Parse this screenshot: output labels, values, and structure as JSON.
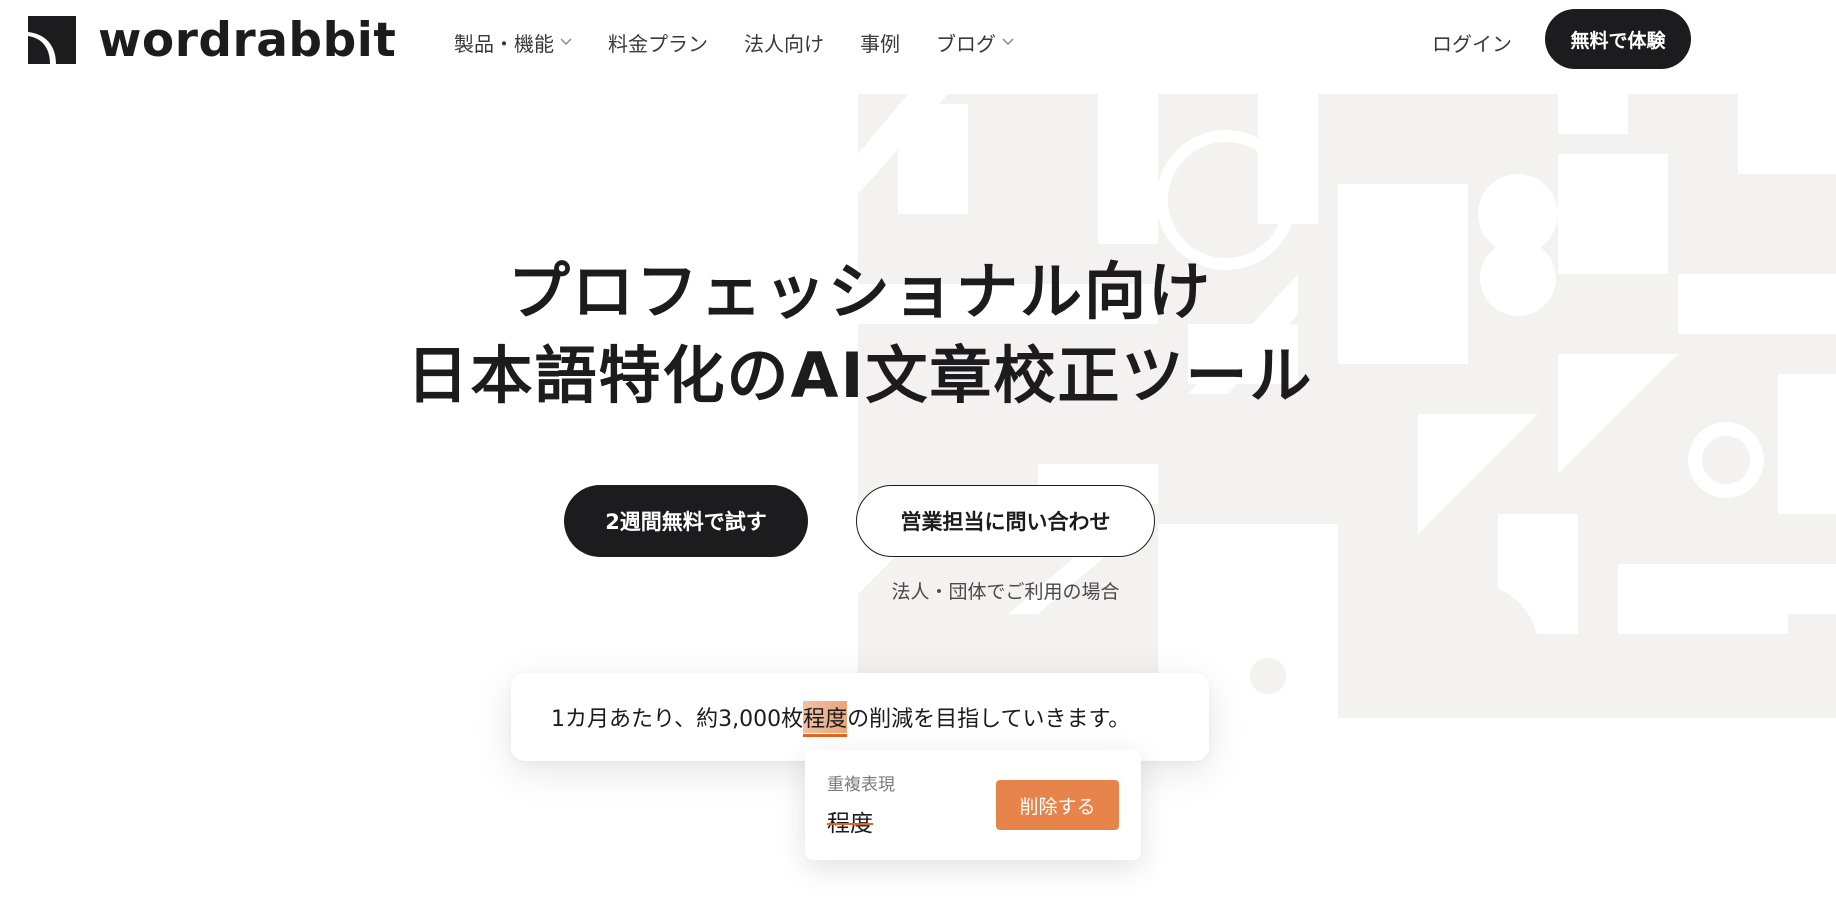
{
  "brand": {
    "name": "wordrabbit",
    "logo_icon": "wordrabbit-logo-icon"
  },
  "nav": {
    "items": [
      {
        "label": "製品・機能",
        "has_dropdown": true
      },
      {
        "label": "料金プラン",
        "has_dropdown": false
      },
      {
        "label": "法人向け",
        "has_dropdown": false
      },
      {
        "label": "事例",
        "has_dropdown": false
      },
      {
        "label": "ブログ",
        "has_dropdown": true
      }
    ],
    "login_label": "ログイン",
    "cta_label": "無料で体験"
  },
  "hero": {
    "title_line1": "プロフェッショナル向け",
    "title_line2": "日本語特化のAI文章校正ツール",
    "primary_button": "2週間無料で試す",
    "secondary_button": "営業担当に問い合わせ",
    "secondary_note": "法人・団体でご利用の場合"
  },
  "demo": {
    "sentence_before": "1カ月あたり、約3,000枚",
    "highlighted_word": "程度",
    "sentence_after": "の削減を目指していきます。",
    "suggestion": {
      "category": "重複表現",
      "word": "程度",
      "action_label": "削除する"
    }
  },
  "colors": {
    "primary_dark": "#1c1c1e",
    "accent_orange": "#e6844c",
    "highlight_underline": "#e3661f",
    "background_art": "#f3f2f0"
  }
}
